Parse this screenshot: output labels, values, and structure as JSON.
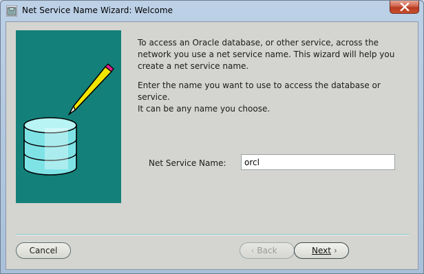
{
  "window": {
    "title": "Net Service Name Wizard: Welcome"
  },
  "intro_text": "To access an Oracle database, or other service, across the\nnetwork you use a net service name.  This wizard will help you\ncreate a net service name.",
  "instruction_text": "Enter the name you want to use to access the database or service.\nIt can be any name you choose.",
  "field": {
    "label": "Net Service Name:",
    "value": "orcl"
  },
  "buttons": {
    "cancel": "Cancel",
    "back": "Back",
    "next": "Next"
  },
  "icons": {
    "title": "database-wizard-icon",
    "close": "close-icon",
    "back": "chevron-left-icon",
    "next": "chevron-right-icon"
  },
  "colors": {
    "illustration_bg": "#138079",
    "database": "#7fe3e6",
    "pencil": "#f2e600"
  }
}
